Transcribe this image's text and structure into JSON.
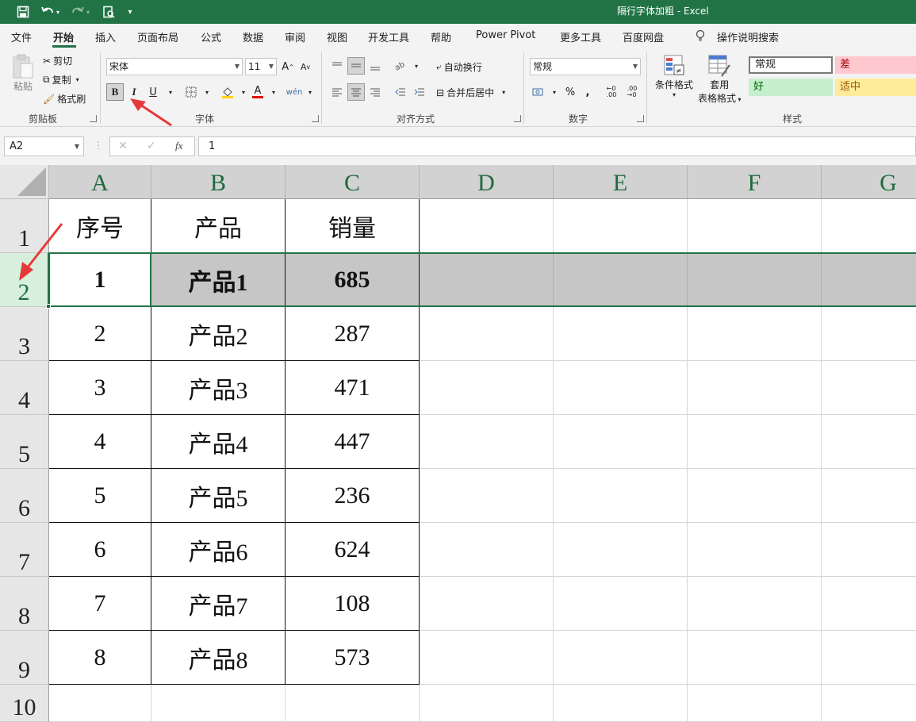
{
  "titlebar": {
    "title": "隔行字体加粗 - Excel"
  },
  "menu": {
    "tabs": [
      "文件",
      "开始",
      "插入",
      "页面布局",
      "公式",
      "数据",
      "审阅",
      "视图",
      "开发工具",
      "帮助",
      "Power Pivot",
      "更多工具",
      "百度网盘"
    ],
    "active": "开始",
    "search_label": "操作说明搜索"
  },
  "ribbon": {
    "clipboard": {
      "paste": "粘贴",
      "cut": "剪切",
      "copy": "复制",
      "format_painter": "格式刷",
      "label": "剪贴板"
    },
    "font": {
      "font_name": "宋体",
      "font_size": "11",
      "bold": "B",
      "italic": "I",
      "underline": "U",
      "label": "字体"
    },
    "alignment": {
      "wrap_text": "自动换行",
      "merge_center": "合并后居中",
      "label": "对齐方式"
    },
    "number": {
      "format": "常规",
      "percent": "%",
      "comma": ",",
      "label": "数字"
    },
    "styles": {
      "conditional_format": "条件格式",
      "table_format_line1": "套用",
      "table_format_line2": "表格格式",
      "cell_normal": "常规",
      "cell_bad": "差",
      "cell_good": "好",
      "cell_neutral": "适中",
      "label": "样式"
    }
  },
  "formula_bar": {
    "name_box": "A2",
    "formula": "1",
    "fx": "fx"
  },
  "sheet": {
    "columns": [
      "A",
      "B",
      "C",
      "D",
      "E",
      "F",
      "G"
    ],
    "row_numbers": [
      "1",
      "2",
      "3",
      "4",
      "5",
      "6",
      "7",
      "8",
      "9",
      "10"
    ],
    "header": [
      "序号",
      "产品",
      "销量"
    ],
    "rows": [
      [
        "1",
        "产品1",
        "685"
      ],
      [
        "2",
        "产品2",
        "287"
      ],
      [
        "3",
        "产品3",
        "471"
      ],
      [
        "4",
        "产品4",
        "447"
      ],
      [
        "5",
        "产品5",
        "236"
      ],
      [
        "6",
        "产品6",
        "624"
      ],
      [
        "7",
        "产品7",
        "108"
      ],
      [
        "8",
        "产品8",
        "573"
      ]
    ]
  },
  "colors": {
    "brand": "#217346",
    "annotation_arrow": "#e8393a",
    "selected_fill": "#c6c6c6"
  }
}
